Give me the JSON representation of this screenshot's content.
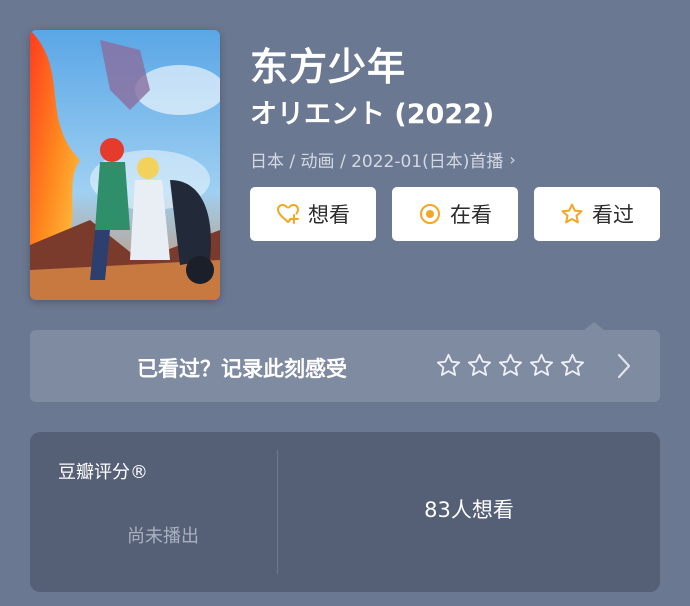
{
  "movie": {
    "title": "东方少年",
    "subtitle": "オリエント (2022)",
    "meta": "日本 / 动画 / 2022-01(日本)首播",
    "meta_chevron": "›"
  },
  "actions": {
    "want_label": "想看",
    "watching_label": "在看",
    "watched_label": "看过",
    "accent": "#f5a623"
  },
  "rating_prompt": {
    "text": "已看过？记录此刻感受",
    "stars": 0,
    "star_max": 5
  },
  "douban_score": {
    "label": "豆瓣评分®",
    "status": "尚未播出",
    "want_count": "83人想看"
  },
  "icons": [
    "heart-plus-icon",
    "target-circle-icon",
    "star-outline-icon",
    "chevron-right-icon"
  ]
}
